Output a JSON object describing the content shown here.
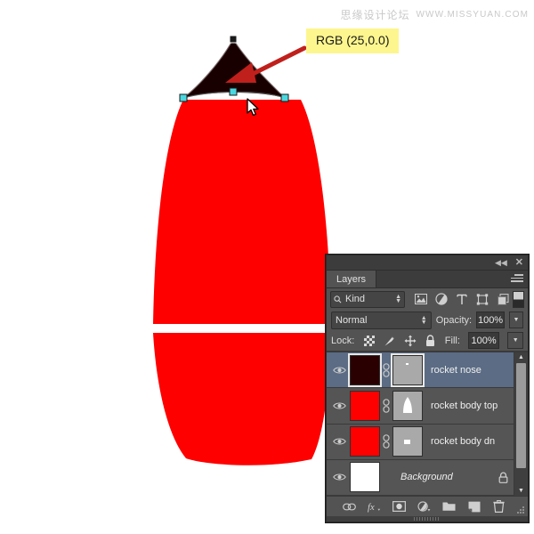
{
  "watermark": {
    "cn": "思缘设计论坛",
    "url": "WWW.MISSYUAN.COM"
  },
  "callout": {
    "text": "RGB (25,0.0)",
    "bg_color": "#fdf68e",
    "arrow_color": "#c0201c"
  },
  "artwork": {
    "nose_color": "#190000",
    "body_color": "#fe0000",
    "anchor_color": "#4ad8e0",
    "path_stroke": "#3a3a3a",
    "corner_anchor_color": "#1a1a1a"
  },
  "panel": {
    "title_tab": "Layers",
    "collapse_icon": "collapse-icon",
    "close_icon": "close-icon",
    "menu_icon": "panel-menu-icon",
    "filter": {
      "kind_label": "Kind",
      "search_icon": "search-icon",
      "icons": [
        "pixel-filter-icon",
        "adjustment-filter-icon",
        "type-filter-icon",
        "shape-filter-icon",
        "smartobject-filter-icon"
      ],
      "toggle_icon": "filter-toggle-icon"
    },
    "blend": {
      "mode": "Normal",
      "opacity_label": "Opacity:",
      "opacity_value": "100%"
    },
    "lock": {
      "label": "Lock:",
      "icons": [
        "lock-transparency-icon",
        "lock-image-icon",
        "lock-position-icon",
        "lock-all-icon"
      ],
      "fill_label": "Fill:",
      "fill_value": "100%"
    },
    "layers": [
      {
        "name": "rocket nose",
        "visible": true,
        "selected": true,
        "thumb_color": "#2b0000",
        "mask": true,
        "mask_bg": "#a9a9a9",
        "mask_shape": "tiny-dot",
        "linked": true,
        "locked": false,
        "italic": false
      },
      {
        "name": "rocket body top",
        "visible": true,
        "selected": false,
        "thumb_color": "#fe0000",
        "mask": true,
        "mask_bg": "#a9a9a9",
        "mask_shape": "nose-blob",
        "linked": true,
        "locked": false,
        "italic": false
      },
      {
        "name": "rocket body dn",
        "visible": true,
        "selected": false,
        "thumb_color": "#fe0000",
        "mask": true,
        "mask_bg": "#a9a9a9",
        "mask_shape": "small-square",
        "linked": true,
        "locked": false,
        "italic": false
      },
      {
        "name": "Background",
        "visible": true,
        "selected": false,
        "thumb_color": "#ffffff",
        "mask": false,
        "linked": false,
        "locked": true,
        "italic": true
      }
    ],
    "footer_icons": [
      "link-layers-icon",
      "layer-style-fx-icon",
      "add-mask-icon",
      "adjustment-layer-icon",
      "new-group-icon",
      "new-layer-icon",
      "delete-layer-icon"
    ],
    "scrollbar": {
      "up_icon": "scroll-up-icon",
      "down_icon": "scroll-down-icon"
    }
  }
}
